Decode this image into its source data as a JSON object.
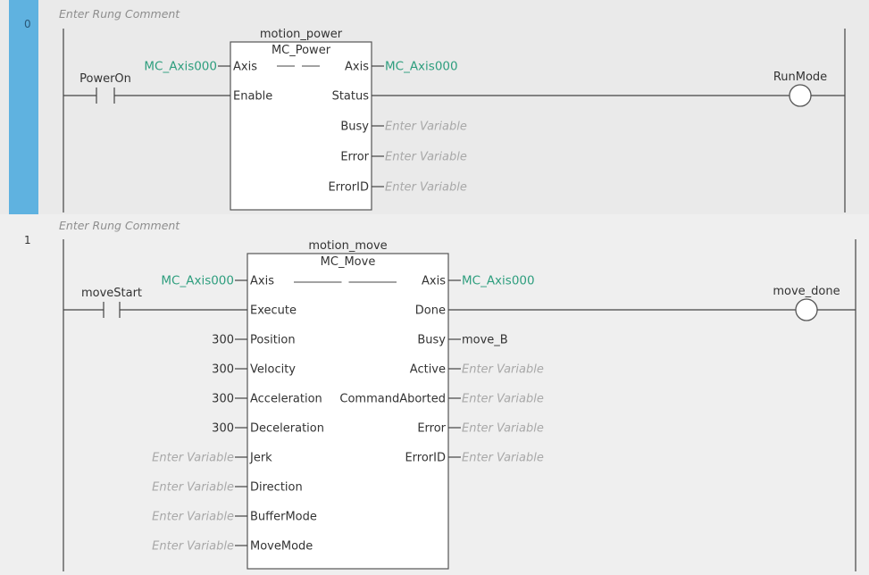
{
  "rungs": [
    {
      "number": "0",
      "comment": "Enter Rung Comment",
      "contact": "PowerOn",
      "coil": "RunMode",
      "block": {
        "instance": "motion_power",
        "type": "MC_Power",
        "inputs": [
          {
            "pin": "Axis",
            "var": "MC_Axis000"
          },
          {
            "pin": "Enable",
            "var": ""
          }
        ],
        "outputs": [
          {
            "pin": "Axis",
            "var": "MC_Axis000"
          },
          {
            "pin": "Status",
            "var": ""
          },
          {
            "pin": "Busy",
            "var": "Enter Variable"
          },
          {
            "pin": "Error",
            "var": "Enter Variable"
          },
          {
            "pin": "ErrorID",
            "var": "Enter Variable"
          }
        ]
      }
    },
    {
      "number": "1",
      "comment": "Enter Rung Comment",
      "contact": "moveStart",
      "coil": "move_done",
      "block": {
        "instance": "motion_move",
        "type": "MC_Move",
        "inputs": [
          {
            "pin": "Axis",
            "var": "MC_Axis000"
          },
          {
            "pin": "Execute",
            "var": ""
          },
          {
            "pin": "Position",
            "var": "300"
          },
          {
            "pin": "Velocity",
            "var": "300"
          },
          {
            "pin": "Acceleration",
            "var": "300"
          },
          {
            "pin": "Deceleration",
            "var": "300"
          },
          {
            "pin": "Jerk",
            "var": "Enter Variable"
          },
          {
            "pin": "Direction",
            "var": "Enter Variable"
          },
          {
            "pin": "BufferMode",
            "var": "Enter Variable"
          },
          {
            "pin": "MoveMode",
            "var": "Enter Variable"
          }
        ],
        "outputs": [
          {
            "pin": "Axis",
            "var": "MC_Axis000"
          },
          {
            "pin": "Done",
            "var": ""
          },
          {
            "pin": "Busy",
            "var": "move_B"
          },
          {
            "pin": "Active",
            "var": "Enter Variable"
          },
          {
            "pin": "CommandAborted",
            "var": "Enter Variable"
          },
          {
            "pin": "Error",
            "var": "Enter Variable"
          },
          {
            "pin": "ErrorID",
            "var": "Enter Variable"
          }
        ]
      }
    }
  ],
  "colors": {
    "selected_rung": "#5fb2e0",
    "variable": "#2e9e7e",
    "placeholder": "#a8a8a8",
    "wire": "#444444"
  },
  "icons": [
    "contact-icon",
    "coil-icon",
    "function-block-icon"
  ]
}
